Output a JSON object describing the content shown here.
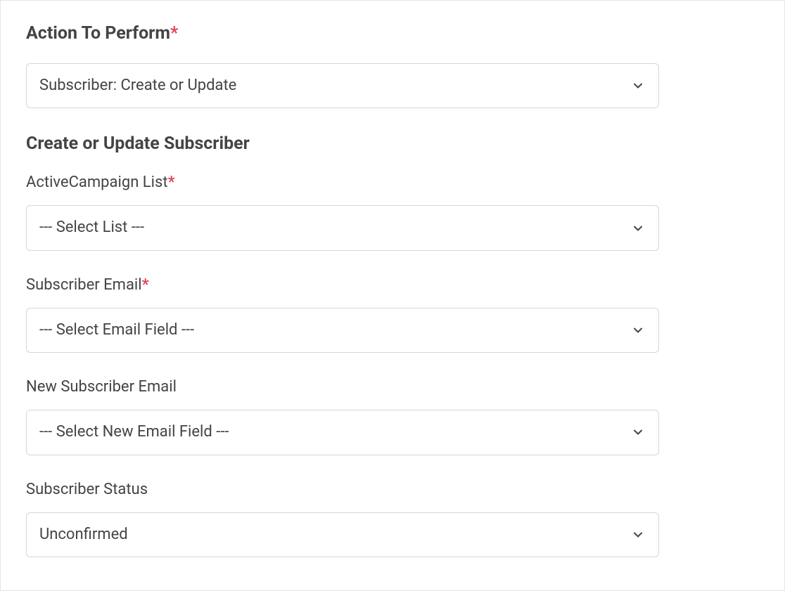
{
  "heading_action": "Action To Perform",
  "heading_section": "Create or Update Subscriber",
  "required_marker": "*",
  "fields": {
    "action": {
      "value": "Subscriber: Create or Update"
    },
    "list": {
      "label": "ActiveCampaign List",
      "required": true,
      "value": "--- Select List ---"
    },
    "email": {
      "label": "Subscriber Email",
      "required": true,
      "value": "--- Select Email Field ---"
    },
    "new_email": {
      "label": "New Subscriber Email",
      "required": false,
      "value": "--- Select New Email Field ---"
    },
    "status": {
      "label": "Subscriber Status",
      "required": false,
      "value": "Unconfirmed"
    }
  }
}
